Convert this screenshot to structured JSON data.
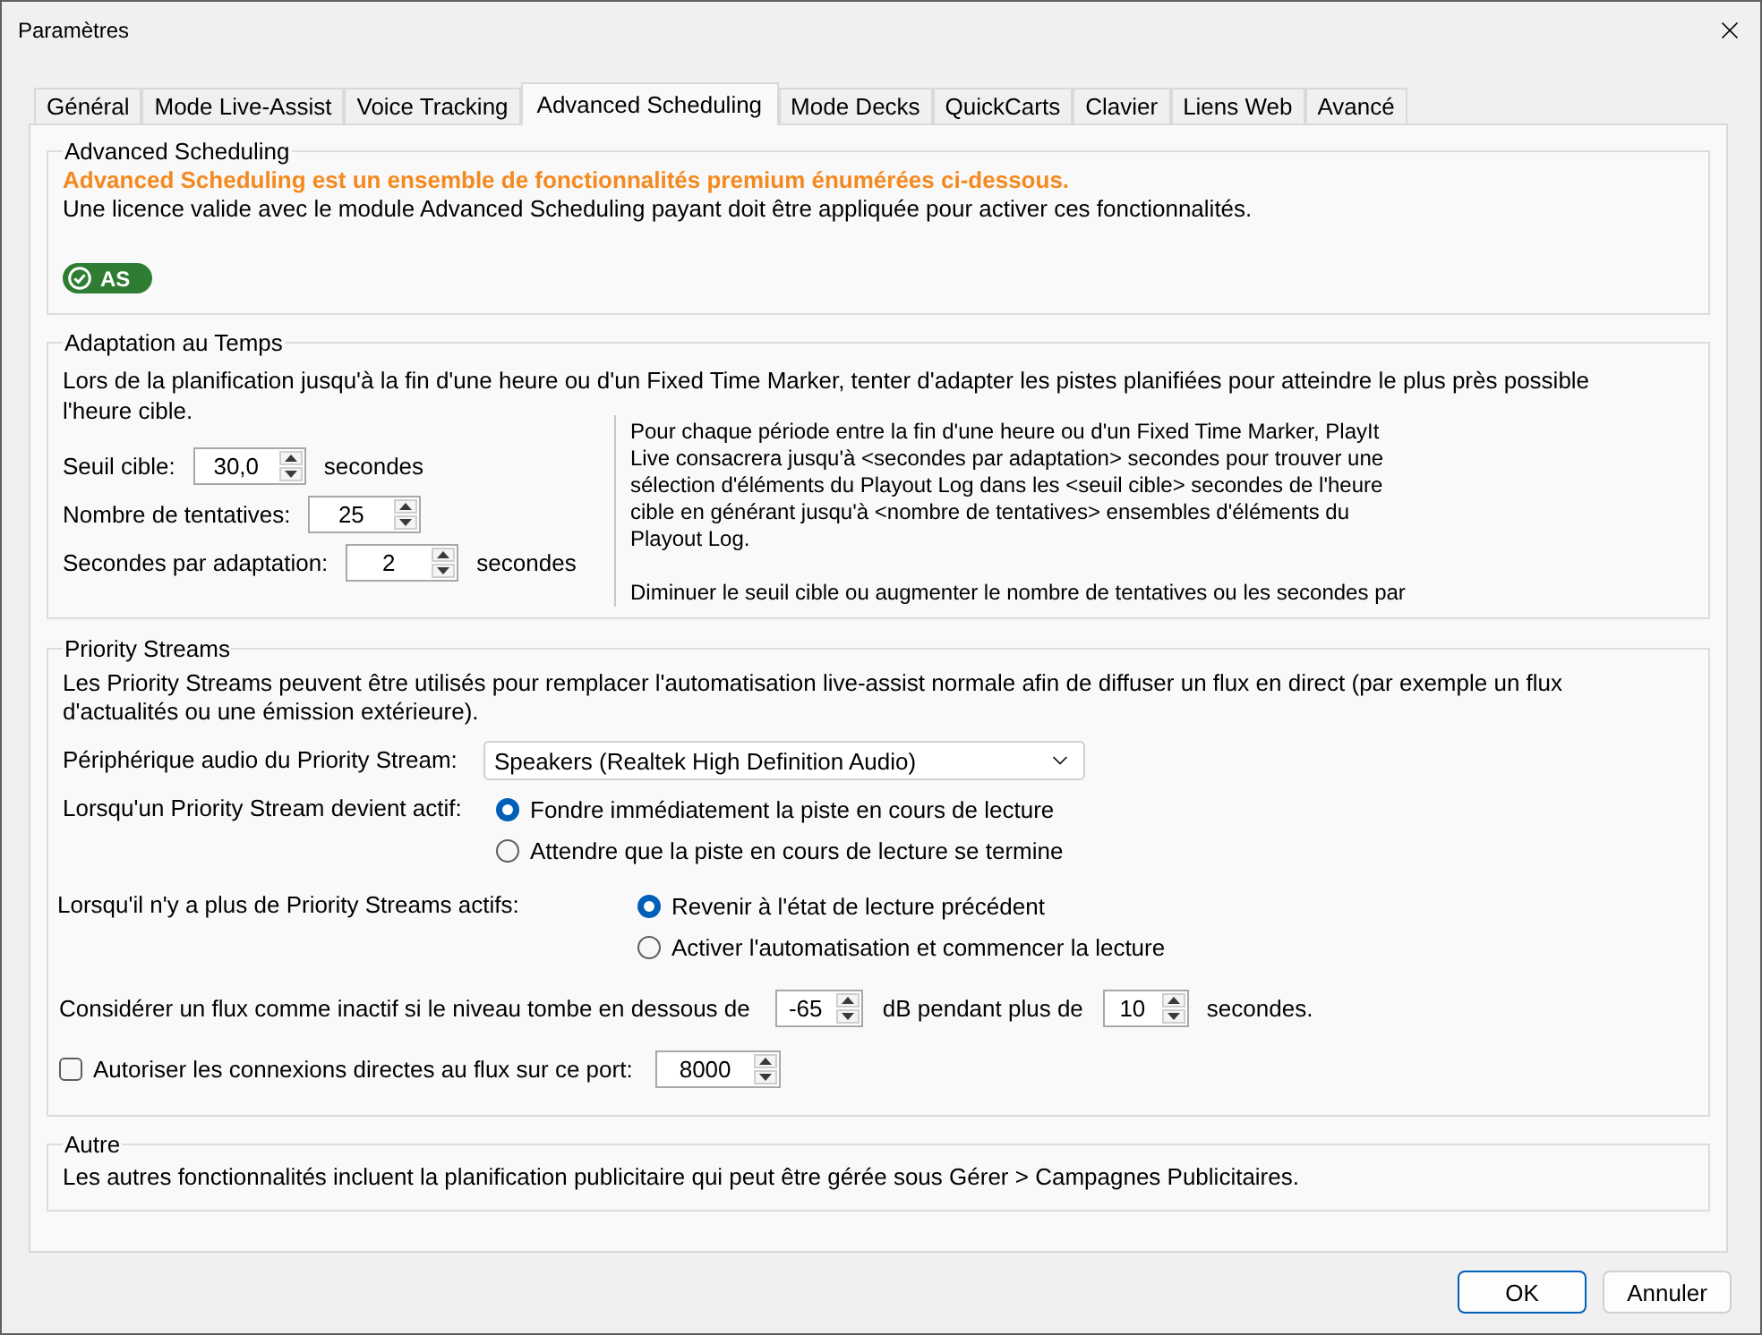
{
  "window": {
    "title": "Paramètres"
  },
  "tabs": [
    {
      "label": "Général",
      "selected": false
    },
    {
      "label": "Mode Live-Assist",
      "selected": false
    },
    {
      "label": "Voice Tracking",
      "selected": false
    },
    {
      "label": "Advanced Scheduling",
      "selected": true
    },
    {
      "label": "Mode Decks",
      "selected": false
    },
    {
      "label": "QuickCarts",
      "selected": false
    },
    {
      "label": "Clavier",
      "selected": false
    },
    {
      "label": "Liens Web",
      "selected": false
    },
    {
      "label": "Avancé",
      "selected": false
    }
  ],
  "advanced_scheduling": {
    "title": "Advanced Scheduling",
    "notice": "Advanced Scheduling est un ensemble de fonctionnalités premium énumérées ci-dessous.",
    "description": "Une licence valide avec le module Advanced Scheduling payant doit être appliquée pour activer ces fonctionnalités.",
    "badge": {
      "label": "AS",
      "active": true
    }
  },
  "time_adaptation": {
    "title": "Adaptation au Temps",
    "description": "Lors de la planification jusqu'à la fin d'une heure ou d'un Fixed Time Marker, tenter d'adapter les pistes planifiées pour atteindre le plus près possible l'heure cible.",
    "fields": [
      {
        "label": "Seuil cible:",
        "value": "30,0",
        "unit": "secondes"
      },
      {
        "label": "Nombre de tentatives:",
        "value": "25"
      },
      {
        "label": "Secondes par adaptation:",
        "value": "2",
        "unit": "secondes"
      }
    ],
    "help": [
      "Pour chaque période entre la fin d'une heure ou d'un Fixed Time Marker, PlayIt Live consacrera jusqu'à <secondes par adaptation> secondes pour trouver une sélection d'éléments du Playout Log dans les <seuil cible> secondes de l'heure cible en générant jusqu'à <nombre de tentatives> ensembles d'éléments du Playout Log.",
      "Diminuer le seuil cible ou augmenter le nombre de tentatives ou les secondes par"
    ]
  },
  "priority_streams": {
    "title": "Priority Streams",
    "description": "Les Priority Streams peuvent être utilisés pour remplacer l'automatisation live-assist normale afin de diffuser un flux en direct (par exemple un flux d'actualités ou une émission extérieure).",
    "audio_device": {
      "label": "Périphérique audio du Priority Stream:",
      "value": "Speakers (Realtek High Definition Audio)"
    },
    "on_active": {
      "label": "Lorsqu'un Priority Stream devient actif:",
      "options": [
        {
          "label": "Fondre immédiatement la piste en cours de lecture",
          "selected": true
        },
        {
          "label": "Attendre que la piste en cours de lecture se termine",
          "selected": false
        }
      ]
    },
    "on_inactive": {
      "label": "Lorsqu'il n'y a plus de Priority Streams actifs:",
      "options": [
        {
          "label": "Revenir à l'état de lecture précédent",
          "selected": true
        },
        {
          "label": "Activer l'automatisation et commencer la lecture",
          "selected": false
        }
      ]
    },
    "silence": {
      "prefix": "Considérer un flux comme inactif si le niveau tombe en dessous de",
      "threshold_value": "-65",
      "middle": "dB pendant plus de",
      "duration_value": "10",
      "suffix": "secondes."
    },
    "direct_connections": {
      "label": "Autoriser les connexions directes au flux sur ce port:",
      "checked": false,
      "port": "8000"
    }
  },
  "other": {
    "title": "Autre",
    "description": "Les autres fonctionnalités incluent la planification publicitaire qui peut être gérée sous Gérer > Campagnes Publicitaires."
  },
  "buttons": [
    {
      "label": "OK",
      "default": true
    },
    {
      "label": "Annuler",
      "default": false
    }
  ]
}
